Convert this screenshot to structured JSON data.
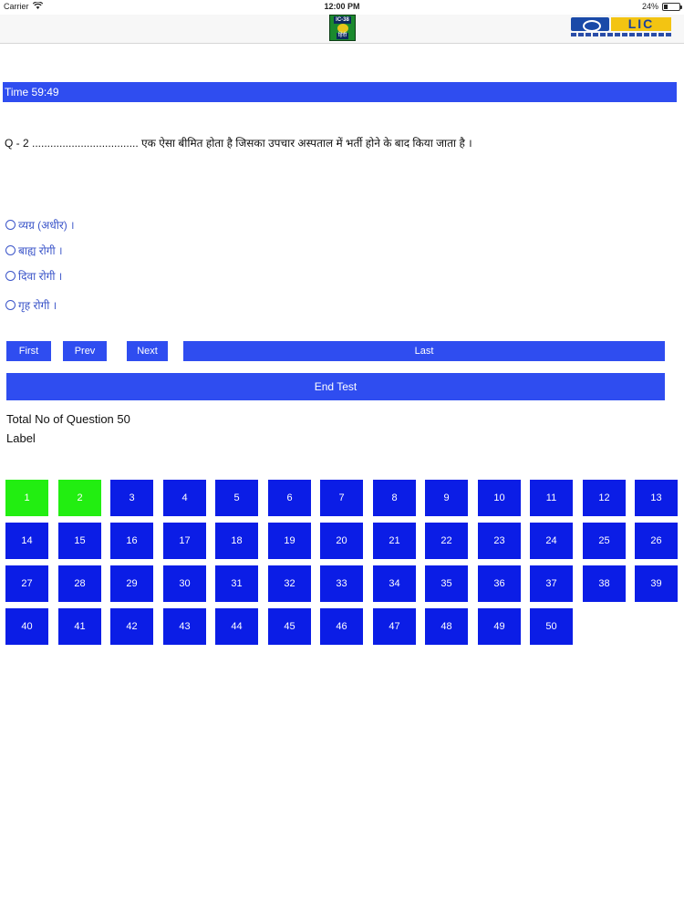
{
  "status_bar": {
    "carrier": "Carrier",
    "time": "12:00 PM",
    "battery": "24%",
    "battery_level": 0.24
  },
  "header": {
    "app_logo_top": "IC-38",
    "app_logo_bottom": "हिंदी",
    "lic_logo_text": "LIC"
  },
  "timer": {
    "text": "Time 59:49"
  },
  "question": {
    "text": "Q - 2 ................................... एक ऐसा बीमित होता है जिसका उपचार अस्पताल में भर्ती होने के बाद किया जाता है ।"
  },
  "options": [
    {
      "label": "व्यग्र (अधीर) ।"
    },
    {
      "label": "बाह्य रोगी ।"
    },
    {
      "label": "दिवा रोगी ।"
    },
    {
      "label": "गृह रोगी ।"
    }
  ],
  "nav": {
    "first": "First",
    "prev": "Prev",
    "next": "Next",
    "last": "Last",
    "end_test": "End Test"
  },
  "summary": {
    "total_questions_text": "Total No of Question 50",
    "label_text": "Label"
  },
  "question_grid": {
    "numbers": [
      "1",
      "2",
      "3",
      "4",
      "5",
      "6",
      "7",
      "8",
      "9",
      "10",
      "11",
      "12",
      "13",
      "14",
      "15",
      "16",
      "17",
      "18",
      "19",
      "20",
      "21",
      "22",
      "23",
      "24",
      "25",
      "26",
      "27",
      "28",
      "29",
      "30",
      "31",
      "32",
      "33",
      "34",
      "35",
      "36",
      "37",
      "38",
      "39",
      "40",
      "41",
      "42",
      "43",
      "44",
      "45",
      "46",
      "47",
      "48",
      "49",
      "50"
    ],
    "answered": [
      "1",
      "2"
    ],
    "colors": {
      "answered": "#22ee11",
      "unanswered": "#0b1de6"
    }
  },
  "colors": {
    "accent": "#2f4df0",
    "option_text": "#3b55c9"
  }
}
